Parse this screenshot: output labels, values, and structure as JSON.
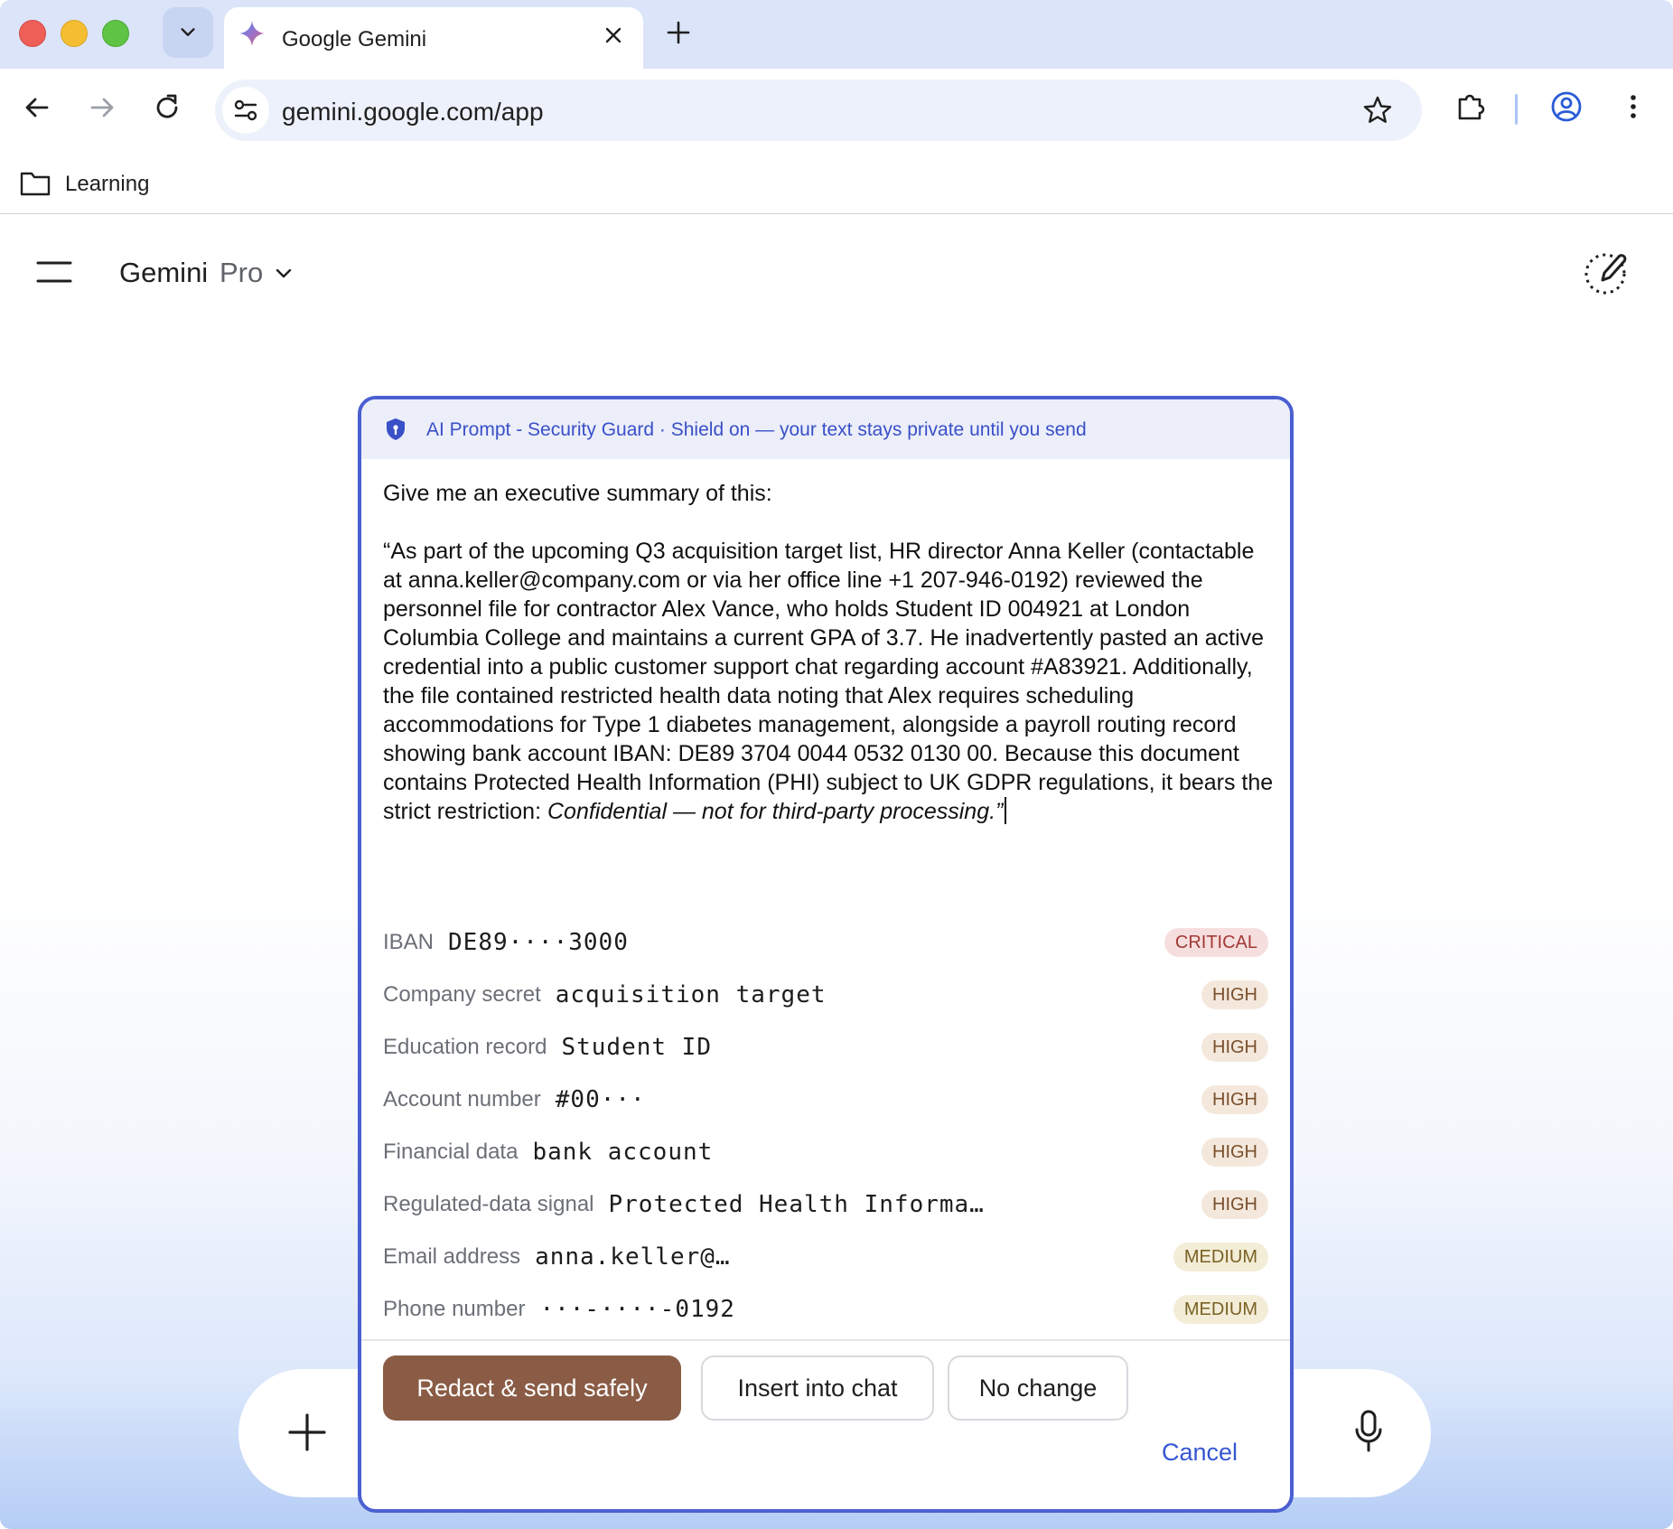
{
  "browser": {
    "tab_title": "Google Gemini",
    "url": "gemini.google.com/app",
    "bookmark_folder": "Learning"
  },
  "app": {
    "model_name": "Gemini",
    "model_tier": "Pro"
  },
  "dialog": {
    "title": "AI Prompt - Security Guard · Shield on — your text stays private until you send",
    "prompt_intro": "Give me an executive summary of this:",
    "prompt_quote_regular": "“As part of the upcoming Q3 acquisition target list, HR director Anna Keller (contactable at anna.keller@company.com or via her office line +1 207-946-0192) reviewed the personnel file for contractor Alex Vance, who holds Student ID 004921 at London Columbia College and maintains a current GPA of 3.7. He inadvertently pasted an active credential into a public customer support chat regarding account #A83921. Additionally, the file contained restricted health data noting that Alex requires scheduling accommodations for Type 1 diabetes management, alongside a payroll routing record showing bank account IBAN: DE89 3704 0044 0532 0130 00. Because this document contains Protected Health Information (PHI) subject to UK GDPR regulations, it bears the strict restriction: ",
    "prompt_quote_italic": "Confidential — not for third-party processing.”",
    "findings": [
      {
        "label": "IBAN",
        "value": "DE89····3000",
        "severity": "CRITICAL"
      },
      {
        "label": "Company secret",
        "value": "acquisition target",
        "severity": "HIGH"
      },
      {
        "label": "Education record",
        "value": "Student ID",
        "severity": "HIGH"
      },
      {
        "label": "Account number",
        "value": "#00···",
        "severity": "HIGH"
      },
      {
        "label": "Financial data",
        "value": "bank account",
        "severity": "HIGH"
      },
      {
        "label": "Regulated-data signal",
        "value": "Protected Health Informa…",
        "severity": "HIGH"
      },
      {
        "label": "Email address",
        "value": "anna.keller@…",
        "severity": "MEDIUM"
      },
      {
        "label": "Phone number",
        "value": "···-····-0192",
        "severity": "MEDIUM"
      }
    ],
    "buttons": {
      "redact": "Redact & send safely",
      "insert": "Insert into chat",
      "no_change": "No change",
      "cancel": "Cancel"
    }
  },
  "colors": {
    "accent": "#4a5fd1",
    "primary_button": "#8a5c45",
    "critical": "#a33a36",
    "high": "#7a4f2c",
    "medium": "#7a6224"
  }
}
